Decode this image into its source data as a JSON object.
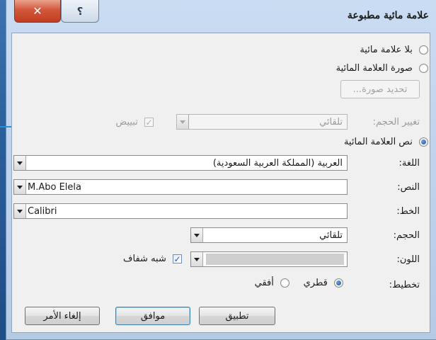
{
  "dialog": {
    "title": "علامة مائية مطبوعة",
    "close_glyph": "✕",
    "help_glyph": "؟"
  },
  "options": {
    "no_watermark": "بلا علامة مائية",
    "picture_watermark": "صورة العلامة المائية",
    "select_picture": "تحديد صورة...",
    "scale_label": "تغيير الحجم:",
    "scale_value": "تلقائي",
    "washout_label": "تبييض",
    "text_watermark": "نص العلامة المائية"
  },
  "fields": {
    "language_label": "اللغة:",
    "language_value": "العربية (المملكة العربية السعودية)",
    "text_label": "النص:",
    "text_value": "M.Abo Elela",
    "font_label": "الخط:",
    "font_value": "Calibri",
    "size_label": "الحجم:",
    "size_value": "تلقائي",
    "color_label": "اللون:",
    "semitransparent_label": "شبه شفاف",
    "layout_label": "تخطيط:",
    "diagonal_label": "قطري",
    "horizontal_label": "أفقي"
  },
  "buttons": {
    "apply": "تطبيق",
    "ok": "موافق",
    "cancel": "إلغاء الأمر"
  },
  "colors": {
    "accent": "#1b4f9c",
    "arrow": "#2b8fd6"
  }
}
